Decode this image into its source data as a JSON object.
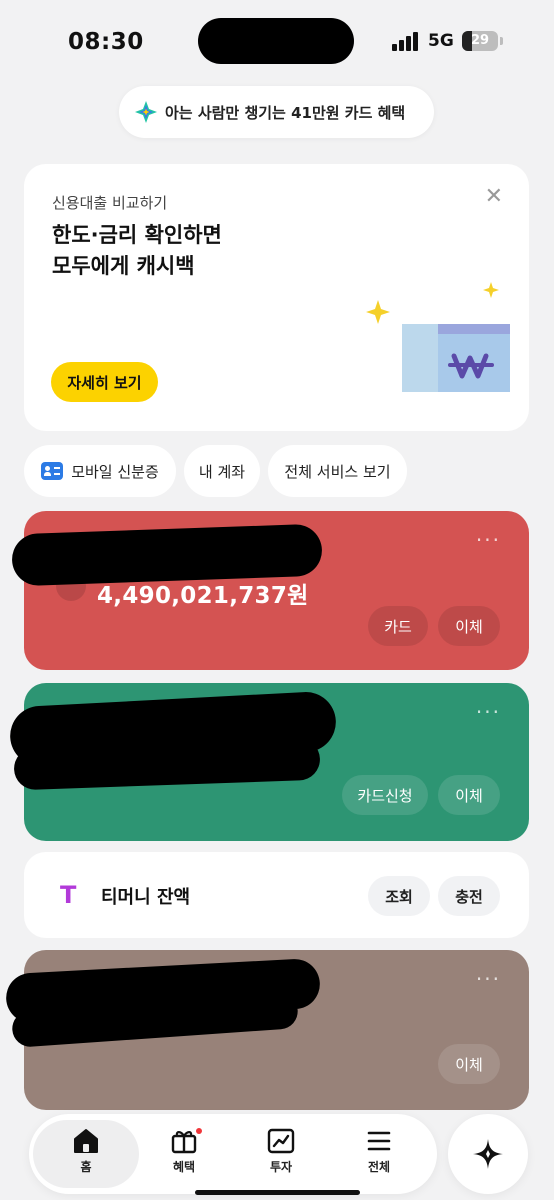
{
  "status": {
    "time": "08:30",
    "network": "5G",
    "battery": "29",
    "battery_level": 0.29
  },
  "promo": {
    "text": "아는 사람만 챙기는 41만원 카드 혜택",
    "icon": "sparkle-icon"
  },
  "loan_card": {
    "subtitle": "신용대출 비교하기",
    "title": "한도·금리 확인하면\n모두에게 캐시백",
    "close_icon": "✕",
    "button": "자세히 보기",
    "accent": "#fcd200"
  },
  "chips": {
    "mobile_id": "모바일 신분증",
    "my_account": "내 계좌",
    "all_services": "전체 서비스 보기"
  },
  "accounts": [
    {
      "color": "#d45352",
      "balance": "4,490,021,737원",
      "buttons": [
        "카드",
        "이체"
      ],
      "more": "···"
    },
    {
      "color": "#2d9573",
      "buttons": [
        "카드신청",
        "이체"
      ],
      "more": "···"
    },
    {
      "color": "#988279",
      "buttons": [
        "이체"
      ],
      "more": "···"
    }
  ],
  "tmoney": {
    "logo": "T",
    "label": "티머니 잔액",
    "buttons": [
      "조회",
      "충전"
    ]
  },
  "tabs": [
    {
      "label": "홈",
      "icon": "home-icon"
    },
    {
      "label": "혜택",
      "icon": "gift-icon"
    },
    {
      "label": "투자",
      "icon": "chart-icon"
    },
    {
      "label": "전체",
      "icon": "menu-icon"
    }
  ]
}
